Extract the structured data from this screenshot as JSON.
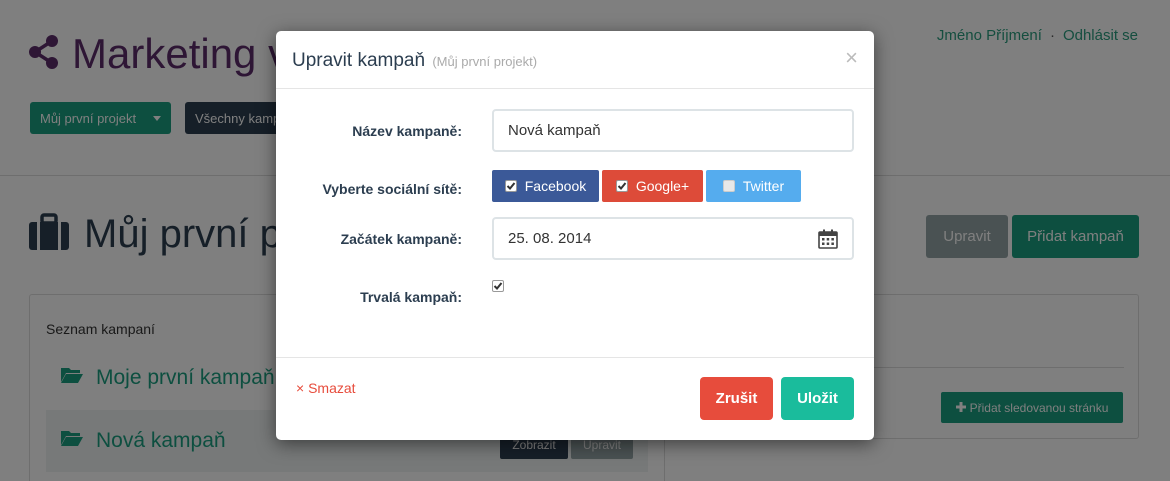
{
  "app": {
    "brand_title": "Marketing v",
    "user_name": "Jméno Příjmení",
    "separator": "·",
    "logout": "Odhlásit se"
  },
  "nav": {
    "project_dropdown": "Můj první projekt",
    "all_campaigns": "Všechny kamp"
  },
  "page": {
    "title": "Můj první p",
    "edit_button": "Upravit",
    "add_campaign_button": "Přidat kampaň"
  },
  "campaign_list": {
    "heading": "Seznam kampaní",
    "items": [
      {
        "label": "Moje první kampaň"
      },
      {
        "label": "Nová kampaň",
        "show_button": "Zobrazit",
        "edit_button": "Upravit"
      }
    ]
  },
  "right_panel": {
    "add_tracked_page": "Přidat sledovanou stránku"
  },
  "modal": {
    "title": "Upravit kampaň",
    "subtitle": "(Můj první projekt)",
    "close": "×",
    "fields": {
      "name_label": "Název kampaně:",
      "name_value": "Nová kampaň",
      "social_label": "Vyberte sociální sítě:",
      "start_label": "Začátek kampaně:",
      "start_value": "25. 08. 2014",
      "permanent_label": "Trvalá kampaň:"
    },
    "social_networks": [
      {
        "label": "Facebook",
        "checked": true,
        "color": "#3b5998"
      },
      {
        "label": "Google+",
        "checked": true,
        "color": "#dd4b39"
      },
      {
        "label": "Twitter",
        "checked": false,
        "color": "#55acee"
      }
    ],
    "permanent_checked": true,
    "delete_link": "× Smazat",
    "cancel_button": "Zrušit",
    "save_button": "Uložit"
  }
}
